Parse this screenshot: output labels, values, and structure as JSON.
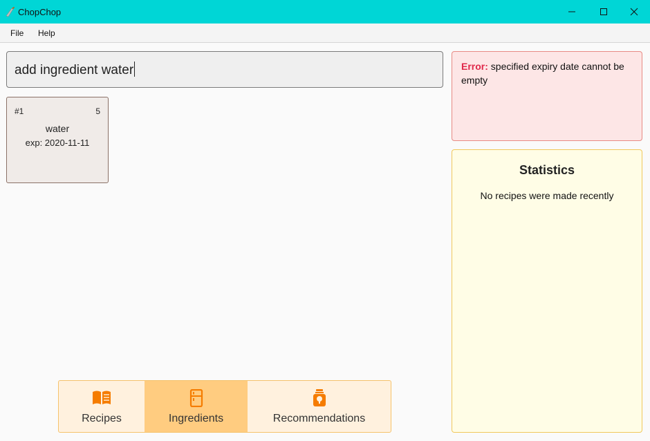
{
  "window": {
    "title": "ChopChop",
    "icon": "knife-icon",
    "controls": [
      "minimize-icon",
      "maximize-icon",
      "close-icon"
    ]
  },
  "menu": {
    "file_label": "File",
    "help_label": "Help"
  },
  "command": {
    "value": "add ingredient water"
  },
  "ingredients": [
    {
      "index": "#1",
      "quantity": "5",
      "name": "water",
      "expiry": "exp: 2020-11-11"
    }
  ],
  "tabs": [
    {
      "label": "Recipes",
      "icon": "book-icon",
      "selected": false
    },
    {
      "label": "Ingredients",
      "icon": "fridge-icon",
      "selected": true
    },
    {
      "label": "Recommendations",
      "icon": "jar-icon",
      "selected": false
    }
  ],
  "error": {
    "label": "Error:",
    "message": "specified expiry date cannot be empty"
  },
  "statistics": {
    "title": "Statistics",
    "message": "No recipes were made recently"
  },
  "colors": {
    "titlebar": "#00d6d6",
    "accent_orange": "#f57c00",
    "selected_tab": "#ffcc80",
    "error_label": "#e0284a",
    "error_bg": "#fde6e6",
    "stats_bg": "#fffde6"
  }
}
